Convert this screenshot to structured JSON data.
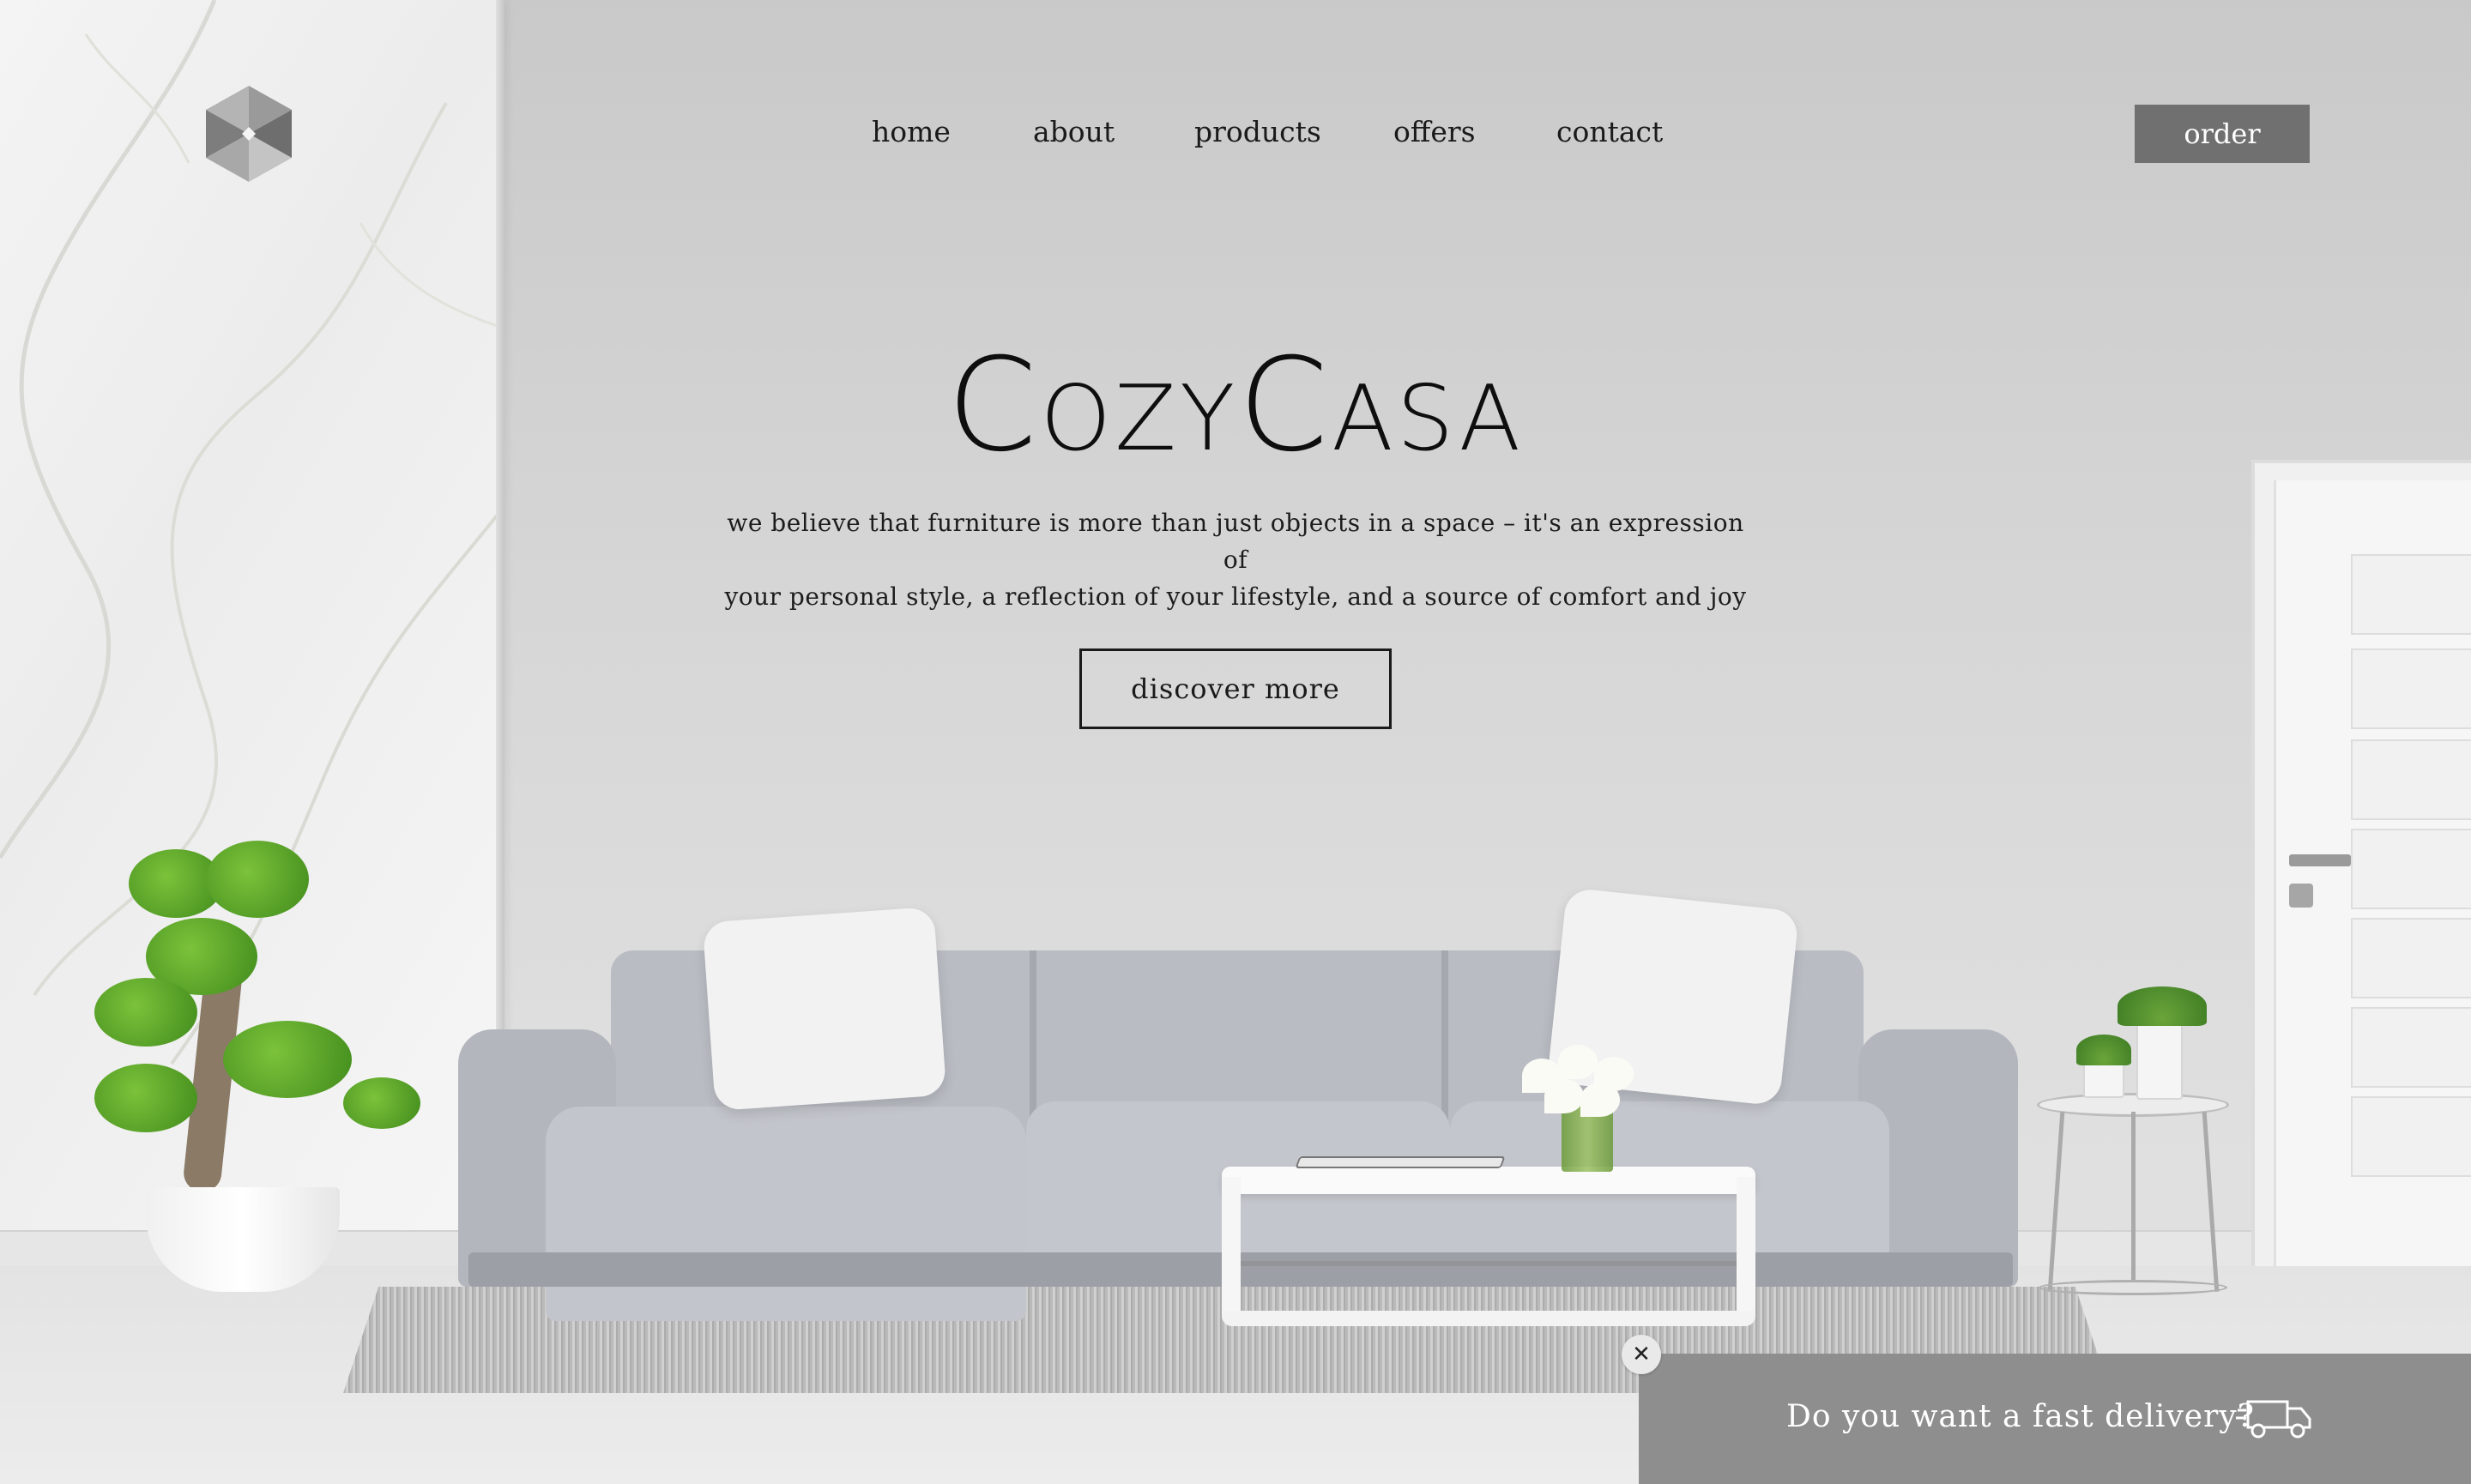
{
  "header": {
    "logo_icon": "cube-logo-icon",
    "nav": [
      {
        "label": "home"
      },
      {
        "label": "about"
      },
      {
        "label": "products"
      },
      {
        "label": "offers"
      },
      {
        "label": "contact"
      }
    ],
    "order_label": "order"
  },
  "hero": {
    "brand": "CozyCasa",
    "tagline_line1": "we believe that furniture is more than just objects in a space – it's an expression of",
    "tagline_line2": "your personal style, a reflection of your lifestyle, and a source of comfort and joy",
    "cta_label": "discover more"
  },
  "delivery": {
    "text": "Do you want a fast delivery?",
    "icon": "delivery-truck-icon",
    "close_glyph": "✕",
    "close_icon": "close-icon"
  },
  "colors": {
    "order_button_bg": "#707070",
    "delivery_banner_bg": "#8e8e8e",
    "text_dark": "#1a1a1a"
  }
}
